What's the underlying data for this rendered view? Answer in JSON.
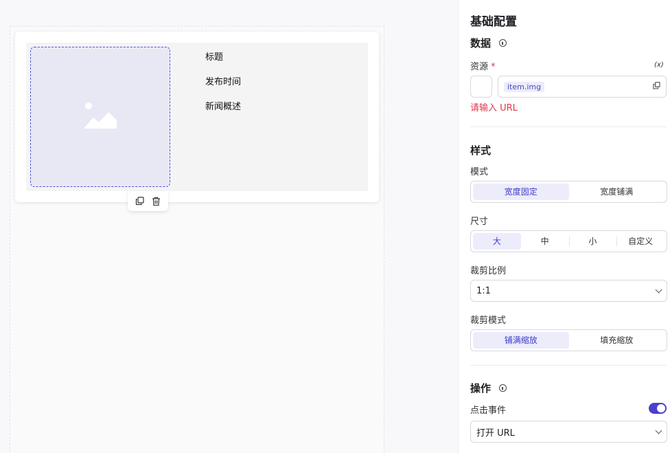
{
  "card": {
    "texts": [
      "标题",
      "发布时间",
      "新闻概述"
    ]
  },
  "panel": {
    "title": "基础配置",
    "data_section": {
      "title": "数据",
      "resource_label": "资源",
      "required_mark": "*",
      "variable_icon": "(x)",
      "resource_tag": "item.img",
      "error": "请输入 URL"
    },
    "style_section": {
      "title": "样式",
      "mode_label": "模式",
      "mode_options": [
        "宽度固定",
        "宽度铺满"
      ],
      "size_label": "尺寸",
      "size_options": [
        "大",
        "中",
        "小",
        "自定义"
      ],
      "crop_ratio_label": "裁剪比例",
      "crop_ratio_value": "1:1",
      "crop_mode_label": "裁剪模式",
      "crop_mode_options": [
        "铺满缩放",
        "填充缩放"
      ]
    },
    "action_section": {
      "title": "操作",
      "click_label": "点击事件",
      "click_enabled": true,
      "click_action_value": "打开 URL"
    }
  },
  "colors": {
    "accent": "#4b3fd0",
    "error": "#e0364a",
    "active_bg": "#ececfb"
  }
}
